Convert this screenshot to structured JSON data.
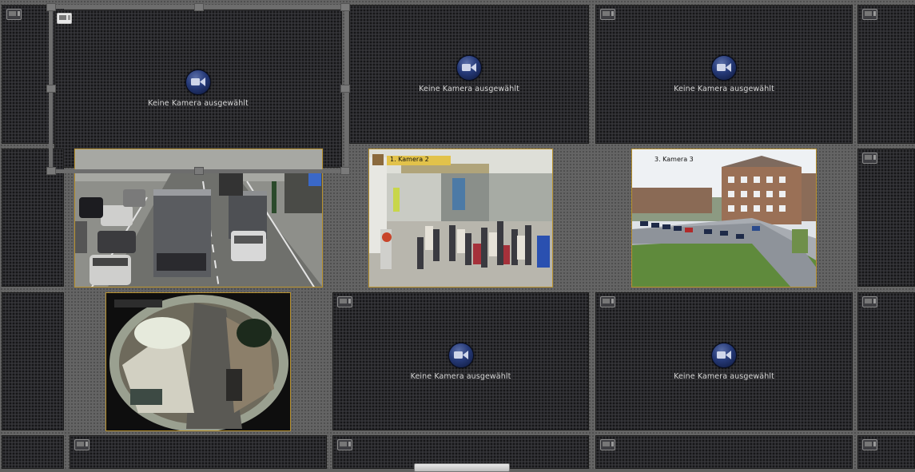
{
  "placeholder_text": "Keine Kamera ausgewählt",
  "feeds": {
    "camera_2_label": "1. Kamera 2",
    "camera_3_label": "3. Kamera 3"
  },
  "icons": {
    "pane_monitor": "monitor-icon",
    "select_camera": "video-camera-icon"
  },
  "colors": {
    "feed_border": "#b9922e",
    "camera_button": "#263a78"
  }
}
